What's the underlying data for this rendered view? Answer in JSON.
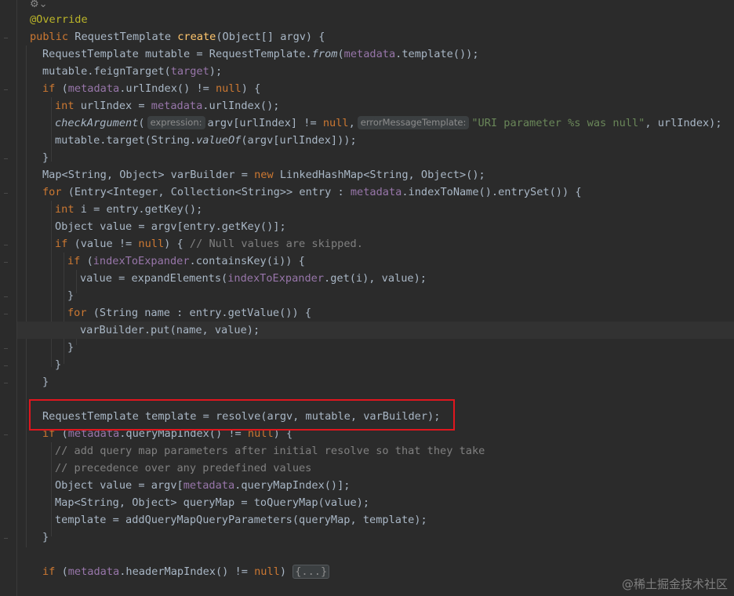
{
  "toolbar": {
    "icon_glyph": "⚙",
    "dropdown_glyph": "⌄"
  },
  "code": {
    "l1": {
      "ann": "@Override"
    },
    "l2": {
      "a": "public ",
      "b": "RequestTemplate ",
      "c": "create",
      "d": "(Object[] argv) {"
    },
    "l3": {
      "a": "RequestTemplate mutable = RequestTemplate.",
      "b": "from",
      "c": "(",
      "d": "metadata",
      "e": ".template());"
    },
    "l4": {
      "a": "mutable.feignTarget(",
      "b": "target",
      "c": ");"
    },
    "l5": {
      "a": "if ",
      "b": "(",
      "c": "metadata",
      "d": ".urlIndex() != ",
      "e": "null",
      "f": ") {"
    },
    "l6": {
      "a": "int ",
      "b": "urlIndex = ",
      "c": "metadata",
      "d": ".urlIndex();"
    },
    "l7": {
      "a": "checkArgument",
      "b": "(",
      "hint1": "expression:",
      "c": "argv[urlIndex] != ",
      "d": "null",
      "e": ",",
      "hint2": "errorMessageTemplate:",
      "f": "\"URI parameter %s was null\"",
      "g": ", urlIndex);"
    },
    "l8": {
      "a": "mutable.target(String.",
      "b": "valueOf",
      "c": "(argv[urlIndex]));"
    },
    "l9": {
      "a": "}"
    },
    "l10": {
      "a": "Map<String, Object> varBuilder = ",
      "b": "new ",
      "c": "LinkedHashMap<String, Object>();"
    },
    "l11": {
      "a": "for ",
      "b": "(Entry<Integer, Collection<String>> entry : ",
      "c": "metadata",
      "d": ".indexToName().entrySet()) {"
    },
    "l12": {
      "a": "int ",
      "b": "i = entry.getKey();"
    },
    "l13": {
      "a": "Object value = argv[entry.getKey()];"
    },
    "l14": {
      "a": "if ",
      "b": "(value != ",
      "c": "null",
      "d": ") { ",
      "e": "// Null values are skipped."
    },
    "l15": {
      "a": "if ",
      "b": "(",
      "c": "indexToExpander",
      "d": ".containsKey(i)) {"
    },
    "l16": {
      "a": "value = expandElements(",
      "b": "indexToExpander",
      "c": ".get(i), value);"
    },
    "l17": {
      "a": "}"
    },
    "l18": {
      "a": "for ",
      "b": "(String name : entry.getValue()) {"
    },
    "l19": {
      "a": "varBuilder.put(name, value);"
    },
    "l20": {
      "a": "}"
    },
    "l21": {
      "a": "}"
    },
    "l22": {
      "a": "}"
    },
    "l24": {
      "a": "RequestTemplate template = resolve(argv, mutable, varBuilder);"
    },
    "l25": {
      "a": "if ",
      "b": "(",
      "c": "metadata",
      "d": ".queryMapIndex() != ",
      "e": "null",
      "f": ") {"
    },
    "l26": {
      "a": "// add query map parameters after initial resolve so that they take"
    },
    "l27": {
      "a": "// precedence over any predefined values"
    },
    "l28": {
      "a": "Object value = argv[",
      "b": "metadata",
      "c": ".queryMapIndex()];"
    },
    "l29": {
      "a": "Map<String, Object> queryMap = toQueryMap(value);"
    },
    "l30": {
      "a": "template = addQueryMapQueryParameters(queryMap, template);"
    },
    "l31": {
      "a": "}"
    },
    "l33": {
      "a": "if ",
      "b": "(",
      "c": "metadata",
      "d": ".headerMapIndex() != ",
      "e": "null",
      "f": ") ",
      "fold": "{...}"
    }
  },
  "watermark": "@稀土掘金技术社区"
}
